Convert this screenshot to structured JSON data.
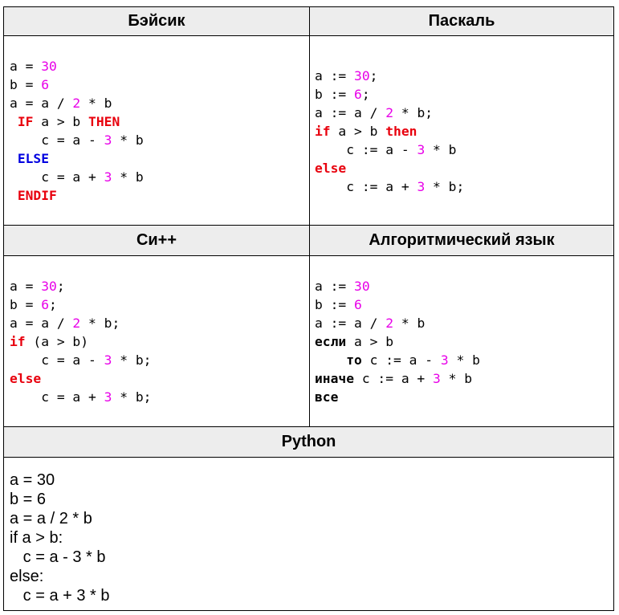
{
  "headers": {
    "basic": "Бэйсик",
    "pascal": "Паскаль",
    "cpp": "Си++",
    "algo": "Алгоритмический язык",
    "python": "Python"
  },
  "colors": {
    "keyword_red": "#e8000d",
    "keyword_blue": "#0000e0",
    "number_magenta": "#e800e8",
    "header_bg": "#ededed",
    "border": "#000000"
  },
  "code": {
    "basic": [
      [
        {
          "t": "a = "
        },
        {
          "t": "30",
          "c": "num"
        }
      ],
      [
        {
          "t": "b = "
        },
        {
          "t": "6",
          "c": "num"
        }
      ],
      [
        {
          "t": "a = a / "
        },
        {
          "t": "2",
          "c": "num"
        },
        {
          "t": " * b"
        }
      ],
      [
        {
          "t": " "
        },
        {
          "t": "IF",
          "c": "kw-red"
        },
        {
          "t": " a > b "
        },
        {
          "t": "THEN",
          "c": "kw-red"
        }
      ],
      [
        {
          "t": "    c = a - "
        },
        {
          "t": "3",
          "c": "num"
        },
        {
          "t": " * b"
        }
      ],
      [
        {
          "t": " "
        },
        {
          "t": "ELSE",
          "c": "kw-blue"
        }
      ],
      [
        {
          "t": "    c = a + "
        },
        {
          "t": "3",
          "c": "num"
        },
        {
          "t": " * b"
        }
      ],
      [
        {
          "t": " "
        },
        {
          "t": "ENDIF",
          "c": "kw-red"
        }
      ]
    ],
    "pascal": [
      [
        {
          "t": "a := "
        },
        {
          "t": "30",
          "c": "num"
        },
        {
          "t": ";"
        }
      ],
      [
        {
          "t": "b := "
        },
        {
          "t": "6",
          "c": "num"
        },
        {
          "t": ";"
        }
      ],
      [
        {
          "t": "a := a / "
        },
        {
          "t": "2",
          "c": "num"
        },
        {
          "t": " * b;"
        }
      ],
      [
        {
          "t": "if",
          "c": "kw-red"
        },
        {
          "t": " a > b "
        },
        {
          "t": "then",
          "c": "kw-red"
        }
      ],
      [
        {
          "t": "    c := a - "
        },
        {
          "t": "3",
          "c": "num"
        },
        {
          "t": " * b"
        }
      ],
      [
        {
          "t": "else",
          "c": "kw-red"
        }
      ],
      [
        {
          "t": "    c := a + "
        },
        {
          "t": "3",
          "c": "num"
        },
        {
          "t": " * b;"
        }
      ]
    ],
    "cpp": [
      [
        {
          "t": "a = "
        },
        {
          "t": "30",
          "c": "num"
        },
        {
          "t": ";"
        }
      ],
      [
        {
          "t": "b = "
        },
        {
          "t": "6",
          "c": "num"
        },
        {
          "t": ";"
        }
      ],
      [
        {
          "t": "a = a / "
        },
        {
          "t": "2",
          "c": "num"
        },
        {
          "t": " * b;"
        }
      ],
      [
        {
          "t": "if",
          "c": "kw-red"
        },
        {
          "t": " (a > b)"
        }
      ],
      [
        {
          "t": "    c = a - "
        },
        {
          "t": "3",
          "c": "num"
        },
        {
          "t": " * b;"
        }
      ],
      [
        {
          "t": "else",
          "c": "kw-red"
        }
      ],
      [
        {
          "t": "    c = a + "
        },
        {
          "t": "3",
          "c": "num"
        },
        {
          "t": " * b;"
        }
      ]
    ],
    "algo": [
      [
        {
          "t": "a := "
        },
        {
          "t": "30",
          "c": "num"
        }
      ],
      [
        {
          "t": "b := "
        },
        {
          "t": "6",
          "c": "num"
        }
      ],
      [
        {
          "t": "a := a / "
        },
        {
          "t": "2",
          "c": "num"
        },
        {
          "t": " * b"
        }
      ],
      [
        {
          "t": "если",
          "c": "kw-bold"
        },
        {
          "t": " a > b"
        }
      ],
      [
        {
          "t": "    "
        },
        {
          "t": "то",
          "c": "kw-bold"
        },
        {
          "t": " c := a - "
        },
        {
          "t": "3",
          "c": "num"
        },
        {
          "t": " * b"
        }
      ],
      [
        {
          "t": "иначе",
          "c": "kw-bold"
        },
        {
          "t": " c := a + "
        },
        {
          "t": "3",
          "c": "num"
        },
        {
          "t": " * b"
        }
      ],
      [
        {
          "t": "все",
          "c": "kw-bold"
        }
      ]
    ],
    "python": [
      "a = 30",
      "b = 6",
      "a = a / 2 * b",
      "if a > b:",
      "   c = a - 3 * b",
      "else:",
      "   c = a + 3 * b"
    ]
  }
}
